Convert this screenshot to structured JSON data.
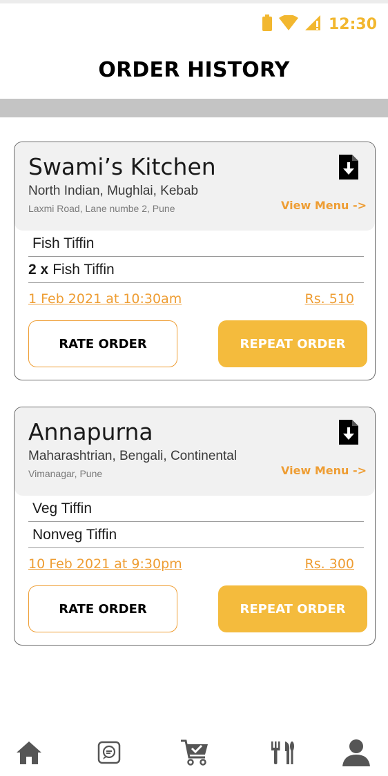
{
  "status_bar": {
    "time": "12:30",
    "icons": [
      "battery-icon",
      "wifi-icon",
      "signal-icon"
    ],
    "accent": "#f2b72f"
  },
  "page": {
    "title": "ORDER HISTORY"
  },
  "colors": {
    "accent": "#ee9d33",
    "button_fill": "#f4bb3d",
    "card_head": "#f1f1f1"
  },
  "orders": [
    {
      "restaurant": "Swami’s Kitchen",
      "cuisine": "North Indian, Mughlai, Kebab",
      "address": "Laxmi Road, Lane numbe 2, Pune",
      "view_menu": "View Menu ->",
      "items": [
        {
          "qty": "",
          "name": "Fish Tiffin"
        },
        {
          "qty": "2 x",
          "name": "Fish Tiffin"
        }
      ],
      "date": "1 Feb 2021 at 10:30am",
      "price": "Rs. 510",
      "rate_label": "RATE ORDER",
      "repeat_label": "REPEAT ORDER"
    },
    {
      "restaurant": "Annapurna",
      "cuisine": "Maharashtrian, Bengali, Continental",
      "address": "Vimanagar, Pune",
      "view_menu": "View Menu ->",
      "items": [
        {
          "qty": "",
          "name": "Veg Tiffin"
        },
        {
          "qty": "",
          "name": "Nonveg Tiffin"
        }
      ],
      "date": "10 Feb 2021 at 9:30pm",
      "price": "Rs. 300",
      "rate_label": "RATE ORDER",
      "repeat_label": "REPEAT ORDER"
    }
  ],
  "bottom_nav": {
    "items": [
      "home-icon",
      "chat-icon",
      "cart-icon",
      "restaurant-icon",
      "profile-icon"
    ],
    "active": "cart-icon"
  }
}
